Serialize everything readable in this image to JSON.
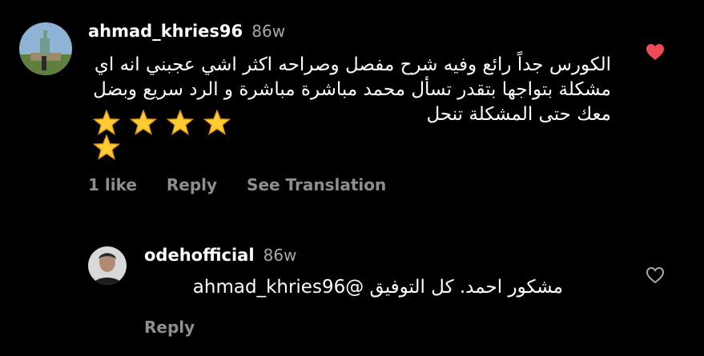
{
  "comment": {
    "username": "ahmad_khries96",
    "time": "86w",
    "text": "الكورس جداً رائع وفيه شرح مفصل وصراحه اكثر اشي عجبني انه اي مشكلة بتواجها بتقدر تسأل محمد مباشرة مباشرة و الرد سريع وبضل معك حتى المشكلة تنحل",
    "stars": "⭐⭐⭐⭐⭐",
    "likes": "1 like",
    "reply_label": "Reply",
    "translation_label": "See Translation",
    "heart_color": "#ed4956",
    "heart_icon": "heart-filled-icon"
  },
  "reply": {
    "username": "odehofficial",
    "time": "86w",
    "text": "مشكور احمد. كل التوفيق @ahmad_khries96",
    "reply_label": "Reply",
    "heart_icon": "heart-outline-icon"
  }
}
